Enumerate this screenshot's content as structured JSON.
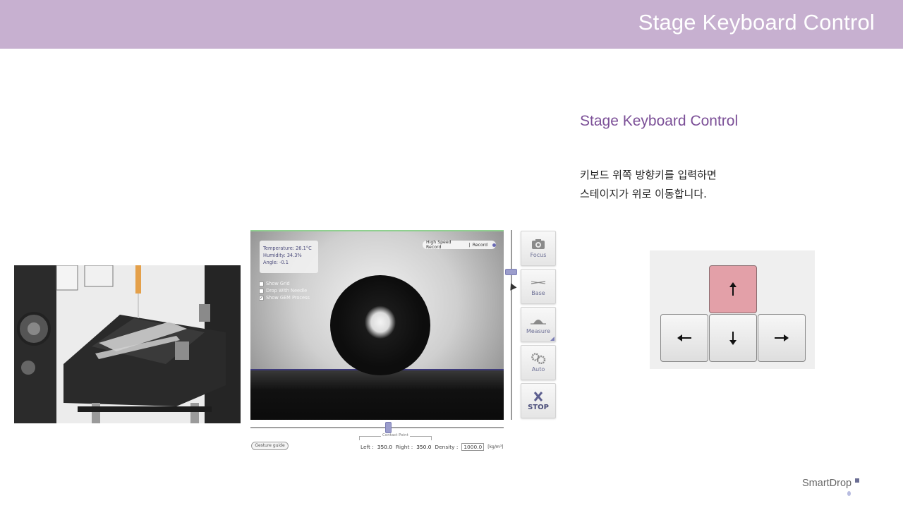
{
  "header": {
    "title": "Stage Keyboard Control"
  },
  "panel": {
    "title": "Stage Keyboard Control",
    "description_lines": [
      "키보드 위쪽 방향키를 입력하면",
      "스테이지가 위로 이동합니다."
    ]
  },
  "keypad": {
    "keys": [
      {
        "name": "up",
        "glyph": "↑",
        "highlighted": true,
        "color": "#e3a0a8"
      },
      {
        "name": "left",
        "glyph": "←"
      },
      {
        "name": "down",
        "glyph": "↓"
      },
      {
        "name": "right",
        "glyph": "→"
      }
    ]
  },
  "software": {
    "sensor": {
      "temperature": "Temperature: 26.1°C",
      "humidity": "Humidity: 34.3%",
      "angle": "Angle: -0.1"
    },
    "options": [
      {
        "label": "Show Grid",
        "checked": false,
        "mark": ""
      },
      {
        "label": "Drop With Needle",
        "checked": false,
        "mark": ""
      },
      {
        "label": "Show GEM Process",
        "checked": true,
        "mark": "✓"
      }
    ],
    "record_bar": {
      "high_speed": "High Speed Record",
      "separator": "|",
      "record": "Record"
    },
    "tools": {
      "focus": "Focus",
      "base": "Base",
      "measure": "Measure",
      "auto": "Auto",
      "stop": "STOP"
    },
    "bottom": {
      "gesture_button": "Gesture guide",
      "contact_point_label": "Contact Point",
      "left_label": "Left :",
      "left_value": "350.0",
      "right_label": "Right :",
      "right_value": "350.0",
      "density_label": "Density :",
      "density_value": "1000.0",
      "density_unit": "[kg/m³]"
    }
  },
  "brand": {
    "logo_text": "SmartDrop"
  }
}
